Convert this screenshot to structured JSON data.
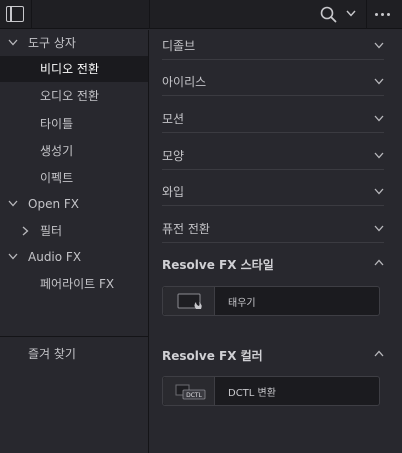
{
  "toolbar": {
    "panel_toggle_icon": "sidebar-panel-icon",
    "search_icon": "search-icon",
    "dropdown_icon": "chevron-down-icon",
    "more_icon": "more-horizontal-icon"
  },
  "sidebar": {
    "items": [
      {
        "label": "도구 상자",
        "expanded": true
      },
      {
        "label": "비디오 전환",
        "selected": true
      },
      {
        "label": "오디오 전환"
      },
      {
        "label": "타이틀"
      },
      {
        "label": "생성기"
      },
      {
        "label": "이펙트"
      },
      {
        "label": "Open FX",
        "expanded": true
      },
      {
        "label": "필터",
        "expanded": false
      },
      {
        "label": "Audio FX",
        "expanded": true
      },
      {
        "label": "페어라이트 FX"
      }
    ],
    "favorites_label": "즐겨 찾기"
  },
  "main": {
    "categories": [
      {
        "label": "디졸브"
      },
      {
        "label": "아이리스"
      },
      {
        "label": "모션"
      },
      {
        "label": "모양"
      },
      {
        "label": "와입"
      },
      {
        "label": "퓨전 전환"
      }
    ],
    "sections": [
      {
        "label": "Resolve FX 스타일",
        "expanded": true,
        "items": [
          {
            "label": "태우기",
            "thumb_icon": "burn-effect-icon"
          }
        ]
      },
      {
        "label": "Resolve FX 컬러",
        "expanded": true,
        "items": [
          {
            "label": "DCTL 변환",
            "thumb_icon": "dctl-icon",
            "thumb_text": "DCTL"
          }
        ]
      }
    ]
  },
  "colors": {
    "background": "#28282e",
    "toolbar": "#1f1f23",
    "selected_row": "#1a1a1e",
    "text": "#c4c4c8"
  }
}
